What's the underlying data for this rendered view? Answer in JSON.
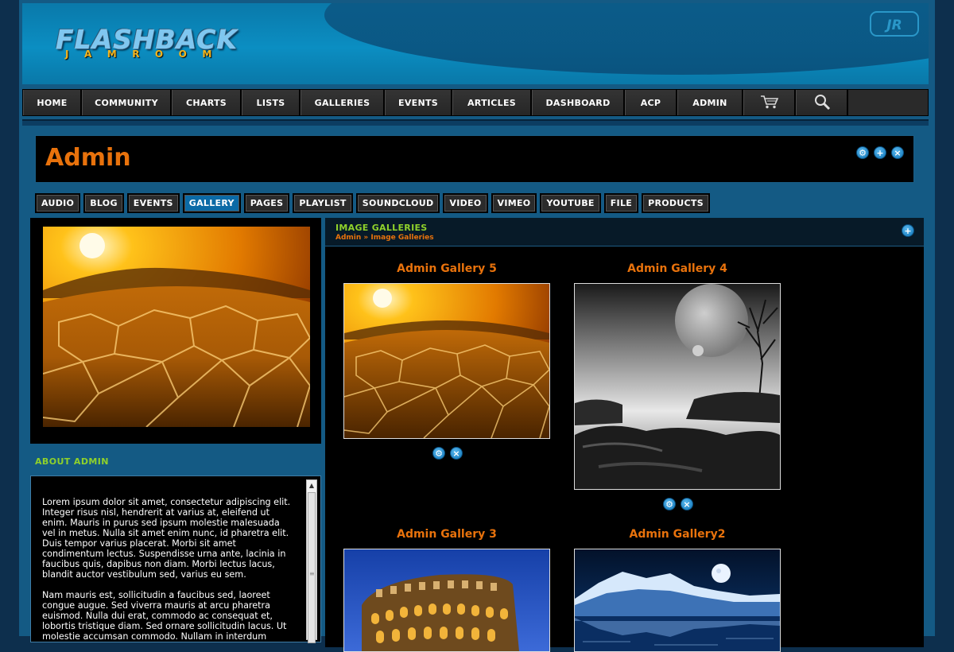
{
  "header": {
    "logo_main": "FLASHBACK",
    "logo_sub": "JAMROOM",
    "badge": "JR"
  },
  "nav": {
    "items": [
      "HOME",
      "COMMUNITY",
      "CHARTS",
      "LISTS",
      "GALLERIES",
      "EVENTS",
      "ARTICLES",
      "DASHBOARD",
      "ACP",
      "ADMIN"
    ],
    "cart_icon": "cart-icon",
    "search_icon": "search-icon"
  },
  "profile": {
    "title": "Admin",
    "icons": [
      "gear-icon",
      "plus-icon",
      "close-icon"
    ]
  },
  "tabs": {
    "items": [
      "AUDIO",
      "BLOG",
      "EVENTS",
      "GALLERY",
      "PAGES",
      "PLAYLIST",
      "SOUNDCLOUD",
      "VIDEO",
      "VIMEO",
      "YOUTUBE",
      "FILE",
      "PRODUCTS"
    ],
    "active": "GALLERY"
  },
  "about": {
    "heading": "ABOUT ADMIN",
    "paragraphs": [
      "Lorem ipsum dolor sit amet, consectetur adipiscing elit. Integer risus nisl, hendrerit at varius at, eleifend ut enim. Mauris in purus sed ipsum molestie malesuada vel in metus. Nulla sit amet enim nunc, id pharetra elit. Duis tempor varius placerat. Morbi sit amet condimentum lectus. Suspendisse urna ante, lacinia in faucibus quis, dapibus non diam. Morbi lectus lacus, blandit auctor vestibulum sed, varius eu sem.",
      "Nam mauris est, sollicitudin a faucibus sed, laoreet congue augue. Sed viverra mauris at arcu pharetra euismod. Nulla dui erat, commodo ac consequat et, lobortis tristique diam. Sed ornare sollicitudin lacus. Ut molestie accumsan commodo. Nullam in interdum"
    ]
  },
  "galleries": {
    "heading": "IMAGE GALLERIES",
    "breadcrumb": [
      "Admin",
      "»",
      "Image Galleries"
    ],
    "items": [
      {
        "title": "Admin Gallery 5",
        "image": "desert-image"
      },
      {
        "title": "Admin Gallery 4",
        "image": "moon-landscape-image"
      },
      {
        "title": "Admin Gallery 3",
        "image": "colosseum-image"
      },
      {
        "title": "Admin Gallery2",
        "image": "snowy-mountain-lake-image"
      }
    ]
  },
  "colors": {
    "accent_orange": "#e8720c",
    "accent_green": "#8fd12b",
    "icon_blue": "#0d74b8",
    "active_tab": "#0b6aa6"
  }
}
